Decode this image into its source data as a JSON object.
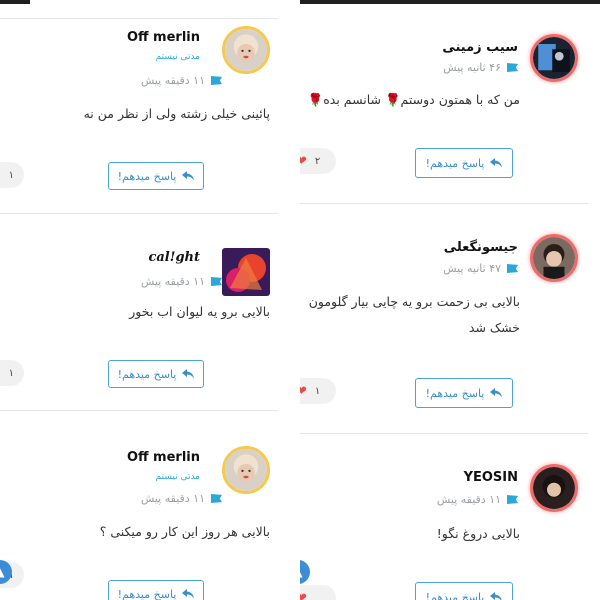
{
  "reply_label": "پاسخ میدهم!",
  "left_column": {
    "comments": [
      {
        "name": "Off merlin",
        "role": "مدتی نیستم",
        "time": "۱۱ دقیقه پیش",
        "text": "پائینی خیلی زشته ولی از نظر من نه",
        "likes": "۱"
      },
      {
        "name": "cal!ght",
        "role": "",
        "time": "۱۱ دقیقه پیش",
        "text": "بالایی برو یه لیوان اب بخور",
        "likes": "۱"
      },
      {
        "name": "Off merlin",
        "role": "مدتی نیستم",
        "time": "۱۱ دقیقه پیش",
        "text": "بالایی هر روز این کار رو میکنی ؟",
        "likes": "۱"
      }
    ]
  },
  "right_column": {
    "comments": [
      {
        "name": "سیب زمینی",
        "time": "۴۶ ثانیه پیش",
        "text": "من که با همتون دوستم🌹 شانسم بده🌹",
        "likes": "۲"
      },
      {
        "name": "جیسونگعلی",
        "time": "۴۷ ثانیه پیش",
        "text": "بالایی بی زحمت برو یه چایی بیار گلومون خشک شد",
        "likes": "۱"
      },
      {
        "name": "YEOSIN",
        "time": "۱۱ دقیقه پیش",
        "text": "بالایی دروغ نگو!",
        "likes": ""
      }
    ]
  },
  "icons": {
    "heart": "heart-icon",
    "reply": "reply-arrow-icon",
    "flag": "flag-icon",
    "scroll_up": "arrow-up-icon"
  },
  "colors": {
    "accent": "#3a8fc9",
    "heart": "#e84a4a",
    "gold_ring": "#f4c94d",
    "red_ring": "#ef6b6b",
    "role": "#2aa8d8"
  }
}
